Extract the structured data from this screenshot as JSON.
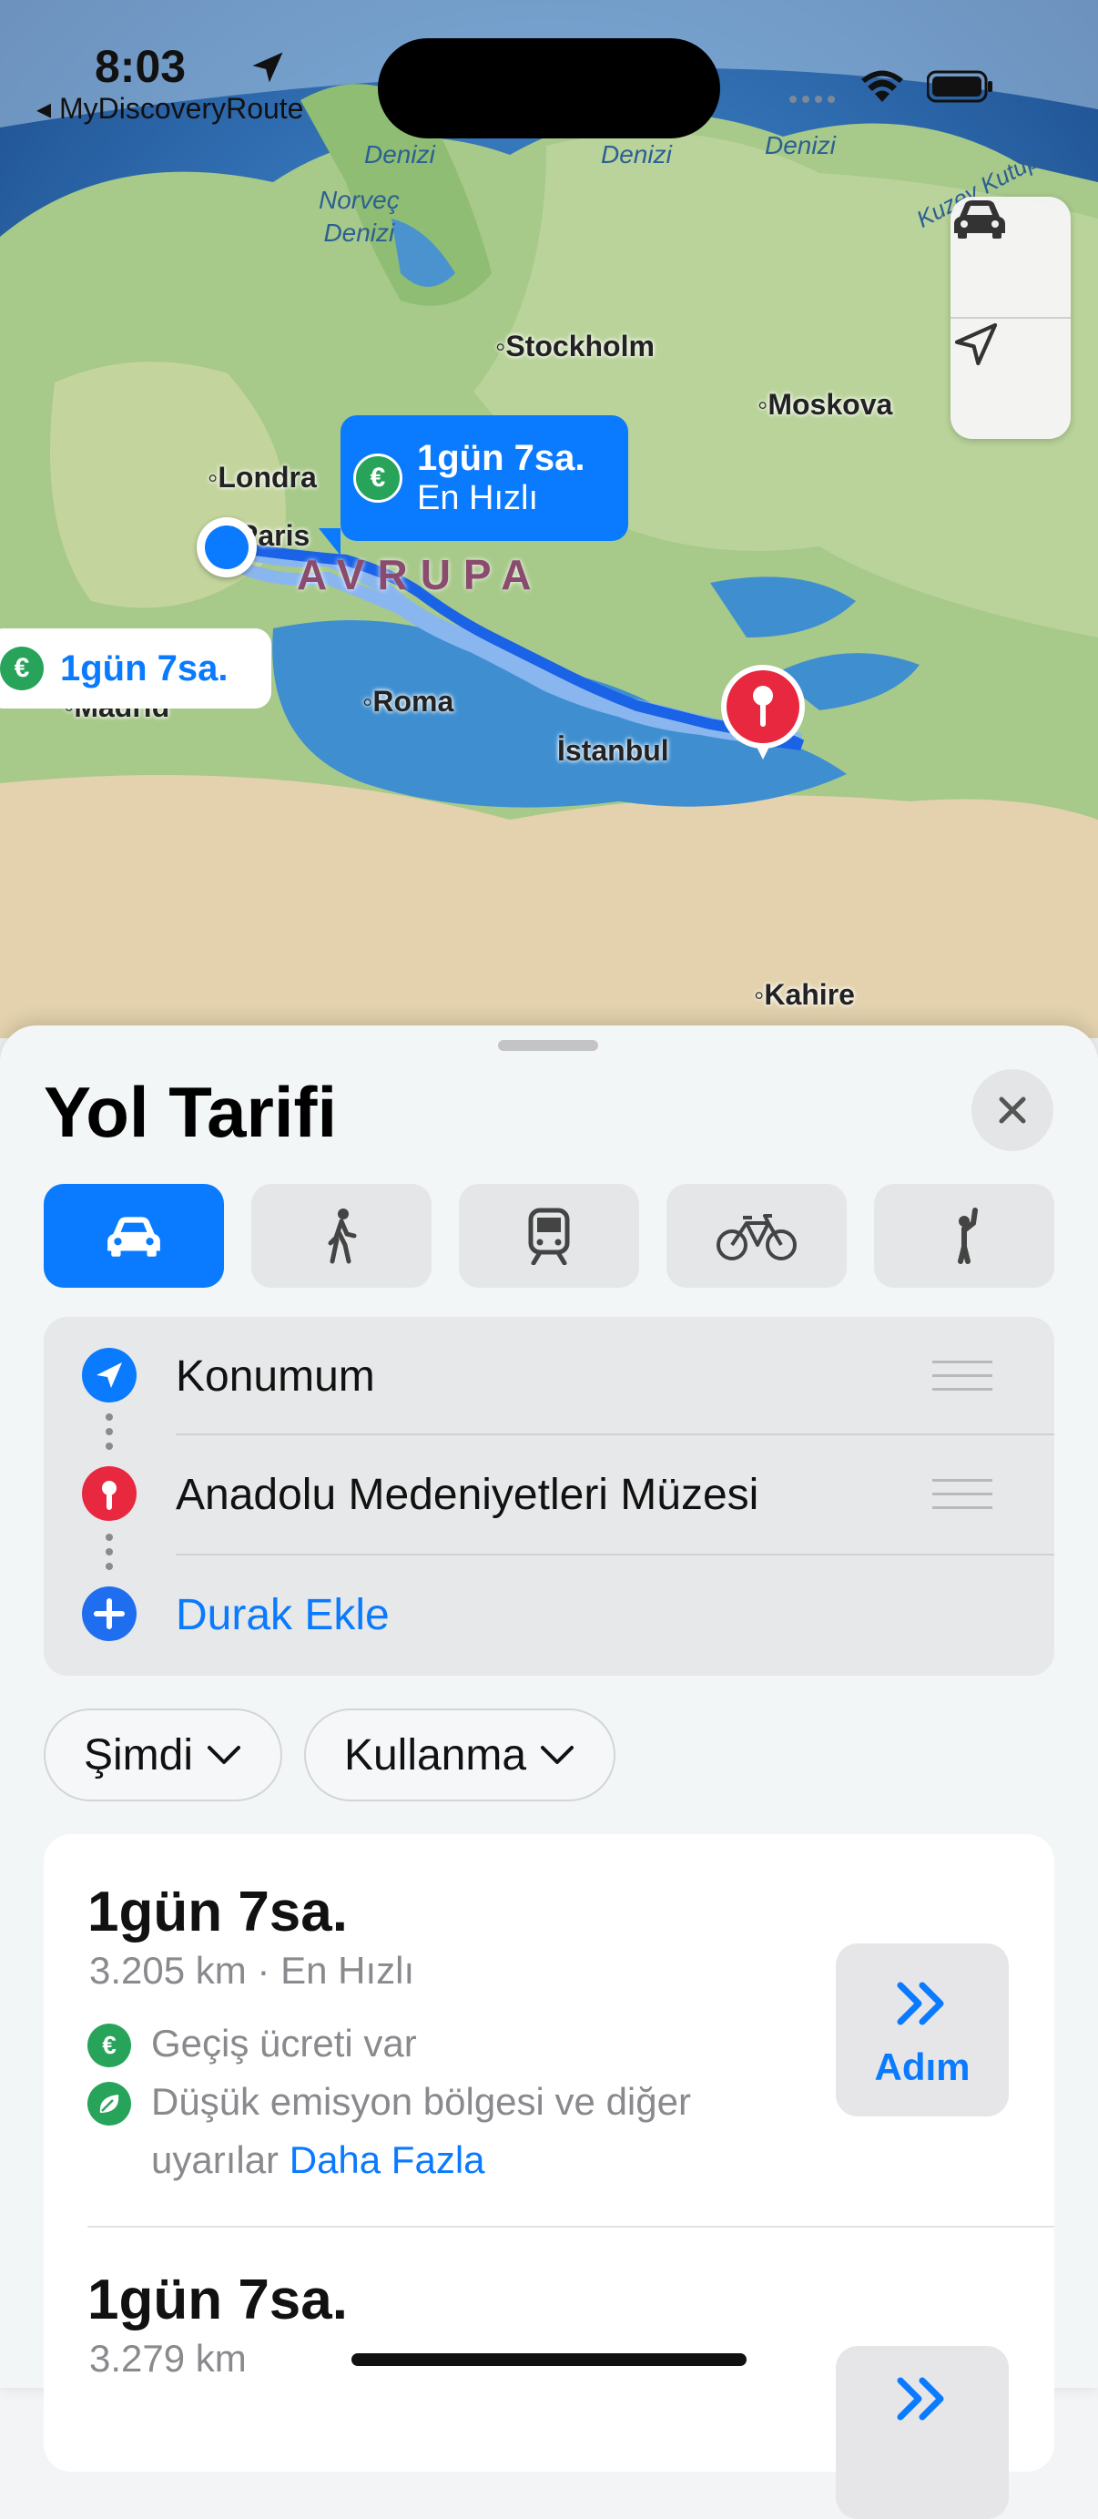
{
  "status": {
    "time": "8:03",
    "back_app": "MyDiscoveryRoute"
  },
  "map": {
    "seas": [
      "Denizi",
      "Denizi",
      "Denizi",
      "Norveç\nDenizi"
    ],
    "region": "AVRUPA",
    "cities": [
      "Stockholm",
      "Moskova",
      "Londra",
      "Paris",
      "Roma",
      "İstanbul",
      "Madrid",
      "Kahire",
      "Kuzey Kutup"
    ],
    "route_primary": {
      "time": "1gün 7sa.",
      "tag": "En Hızlı"
    },
    "route_alt": {
      "time": "1gün 7sa."
    }
  },
  "sheet": {
    "title": "Yol Tarifi",
    "modes": [
      "car",
      "walk",
      "transit",
      "bike",
      "ride"
    ],
    "stops": {
      "origin": "Konumum",
      "destination": "Anadolu Medeniyetleri Müzesi",
      "add": "Durak Ekle"
    },
    "filters": {
      "when": "Şimdi",
      "avoid": "Kullanma"
    },
    "routes": [
      {
        "time": "1gün 7sa.",
        "detail": "3.205 km · En Hızlı",
        "toll": "Geçiş ücreti var",
        "emission": "Düşük emisyon bölgesi ve diğer",
        "emission_2": "uyarılar",
        "more": "Daha Fazla",
        "step_label": "Adım"
      },
      {
        "time": "1gün 7sa.",
        "detail": "3.279 km"
      }
    ]
  },
  "colors": {
    "accent": "#0a7aff",
    "pin": "#e8283f",
    "toll": "#27a45a"
  }
}
